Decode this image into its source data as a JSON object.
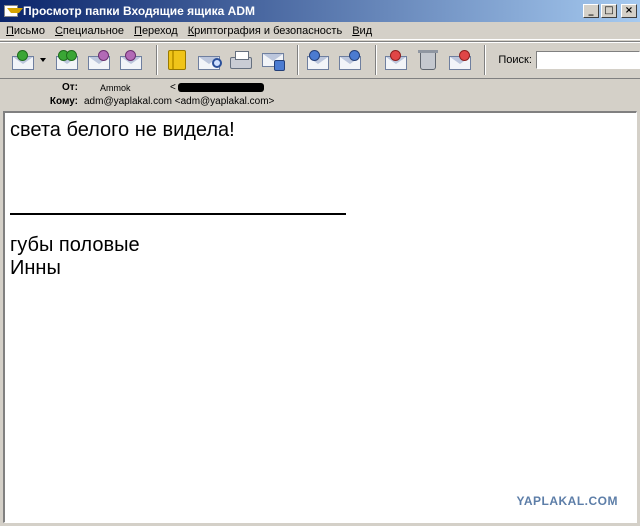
{
  "window": {
    "title": "Просмотр папки Входящие ящика ADM",
    "minimize": "_",
    "maximize": "□",
    "close": "×"
  },
  "menu": {
    "items": [
      "Письмо",
      "Специальное",
      "Переход",
      "Криптография и безопасность",
      "Вид"
    ]
  },
  "toolbar": {
    "search_label": "Поиск:",
    "search_value": ""
  },
  "header": {
    "from_label": "От:",
    "from_value": "Ammok",
    "from_addr_prefix": "<",
    "to_label": "Кому:",
    "to_value": "adm@yaplakal.com <adm@yaplakal.com>"
  },
  "message": {
    "line1": "света белого не видела!",
    "line2": "губы половые",
    "line3": "Инны",
    "watermark": "YAPLAKAL.COM"
  }
}
